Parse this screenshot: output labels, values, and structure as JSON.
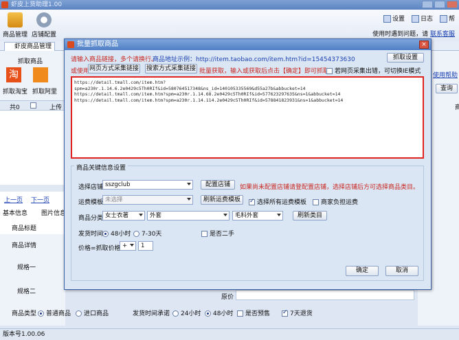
{
  "app": {
    "title": "虾皮上货助理1.00",
    "version": "版本号1.00.06"
  },
  "toolbar": {
    "product_mgmt": "商品管理",
    "shop_config": "店铺配置",
    "settings": "设置",
    "log": "日志",
    "help": "帮",
    "notice": "使用时遇到问题，请",
    "contact": "联系客服"
  },
  "tabs": {
    "main_tab": "虾皮商品管理"
  },
  "left": {
    "fetch_title": "抓取商品",
    "taobao_label": "抓取淘宝",
    "alibaba_label": "抓取阿里",
    "total_label": "共0",
    "upload_label": "上传",
    "prev": "上一页",
    "next": "下一页",
    "basic_info": "基本信息",
    "image_info": "图片信息",
    "prod_title": "商品标题",
    "prod_detail": "商品详情",
    "spec1": "规格一",
    "spec2": "规格二"
  },
  "right": {
    "help": "使用帮助",
    "query": "查询",
    "col": "商"
  },
  "bottom": {
    "prod_type": "商品类型",
    "normal": "普通商品",
    "import": "进口商品",
    "ship_promise": "发货时间承诺",
    "h24": "24小时",
    "h48": "48小时",
    "presale": "是否预售",
    "return7": "7天退货",
    "price": "原价"
  },
  "dialog": {
    "title": "批量抓取商品",
    "hint1": "请输入商品链接，多个请换行。",
    "hint_example": "商品地址示例：http://item.taobao.com/item.htm?id=15454373630",
    "fetch_settings": "抓取设置",
    "or_use": "或使用",
    "web_mode": "网页方式采集链接",
    "search_mode": "搜索方式采集链接",
    "hint2": "批量获取，输入或获取后点击【确定】即可抓取。",
    "ie_mode": "若网页采集出错，可切换IE模式",
    "links": "https://detail.tmall.com/item.htm?\nspm=a230r.1.14.6.2e0429c5Th0RIf&id=580764517348&ns_id=140105335569&d55a27b&abbucket=14\nhttps://detail.tmall.com/item.htm?spm=a230r.1.14.68.2e0429c5Th0RIf&id=577623297635&ns=1&abbucket=14\nhttps://detail.tmall.com/item.htm?spm=a230r.1.14.114.2e0429c5Th0RIf&id=578841823931&ns=1&abbucket=14",
    "group_title": "商品关键信息设置",
    "select_shop": "选择店铺",
    "shop_value": "sszgclub",
    "config_shop": "配置店铺",
    "shop_hint": "如果尚未配置店铺请登配置店铺，选择店铺后方可选择商品类目。",
    "freight_tpl": "运费模板",
    "freight_value": "未选择",
    "refresh_freight": "刷新运费模板",
    "select_all_freight": "选择所有运费模板",
    "merchant_pay": "商家负担运费",
    "category": "商品分类",
    "cat1": "女士衣著",
    "cat2": "外套",
    "cat3": "毛料外套",
    "refresh_cat": "刷新类目",
    "ship_time": "发货时间",
    "h48": "48小时",
    "d7_30": "7-30天",
    "second_hand": "是否二手",
    "price_label": "价格=抓取价格",
    "op": "+",
    "price_value": "1",
    "ok": "确定",
    "cancel": "取消"
  },
  "colors": {
    "accent": "#1a3fb0",
    "alert": "#c8261e",
    "border_red": "#e0231e"
  }
}
